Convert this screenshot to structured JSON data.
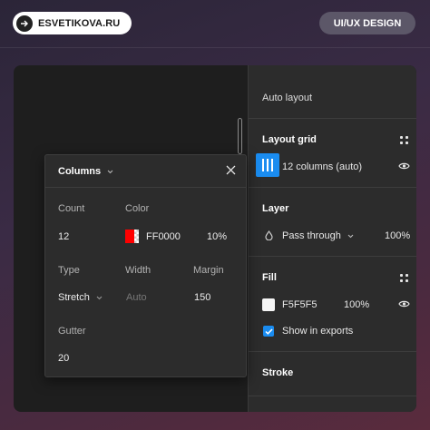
{
  "header": {
    "site_label": "ESVETIKOVA.RU",
    "tag_label": "UI/UX DESIGN"
  },
  "right_panel": {
    "auto_layout_title": "Auto layout",
    "layout_grid": {
      "title": "Layout grid",
      "item_label": "12 columns (auto)"
    },
    "layer": {
      "title": "Layer",
      "blend_mode": "Pass through",
      "opacity": "100%"
    },
    "fill": {
      "title": "Fill",
      "hex": "F5F5F5",
      "opacity": "100%",
      "show_in_exports": "Show in exports"
    },
    "stroke_title": "Stroke"
  },
  "popup": {
    "title": "Columns",
    "count_label": "Count",
    "count_value": "12",
    "color_label": "Color",
    "color_hex": "FF0000",
    "color_opacity": "10%",
    "type_label": "Type",
    "type_value": "Stretch",
    "width_label": "Width",
    "width_value": "Auto",
    "margin_label": "Margin",
    "margin_value": "150",
    "gutter_label": "Gutter",
    "gutter_value": "20"
  },
  "colors": {
    "accent": "#1a8cf0",
    "grid_color": "#ff0000",
    "fill_color": "#f5f5f5"
  }
}
